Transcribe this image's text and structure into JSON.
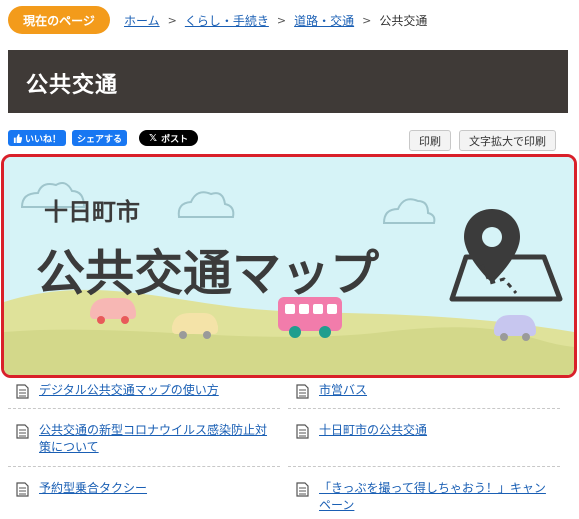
{
  "breadcrumb": {
    "current_label": "現在のページ",
    "items": [
      "ホーム",
      "くらし・手続き",
      "道路・交通"
    ],
    "current_page": "公共交通",
    "separator": ">"
  },
  "page": {
    "title": "公共交通"
  },
  "social": {
    "like_label": "いいね！",
    "share_label": "シェアする",
    "x_label": "ポスト"
  },
  "tools": {
    "print_label": "印刷",
    "large_print_label": "文字拡大で印刷"
  },
  "banner": {
    "subtitle": "十日町市",
    "title": "公共交通マップ"
  },
  "links": [
    [
      "デジタル公共交通マップの使い方",
      "市営バス"
    ],
    [
      "公共交通の新型コロナウイルス感染防止対策について",
      "十日町市の公共交通"
    ],
    [
      "予約型乗合タクシー",
      "「きっぷを撮って得しちゃおう！」キャンペーン"
    ]
  ],
  "colors": {
    "badge": "#f39b1b",
    "title_bar": "#3f3a37",
    "banner_border": "#d9202a",
    "banner_sky": "#d6f3f7",
    "banner_hill": "#dfe29a",
    "link": "#1a5fb4"
  }
}
